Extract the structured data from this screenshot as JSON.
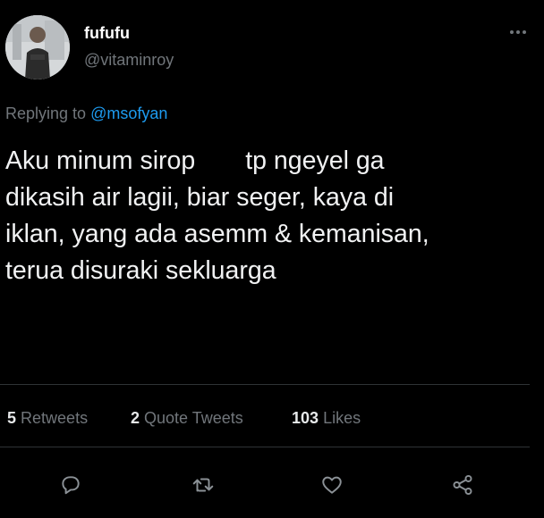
{
  "tweet": {
    "display_name": "fufufu",
    "handle": "@vitaminroy",
    "replying_prefix": "Replying to",
    "replying_to": "@msofyan",
    "body_lines": {
      "line1_a": "Aku minum sirop",
      "line1_b": "tp ngeyel ga",
      "line2": "dikasih air lagii, biar seger, kaya di",
      "line3": "iklan, yang ada asemm & kemanisan,",
      "line4": "terua disuraki sekluarga"
    }
  },
  "stats": {
    "retweets_count": "5",
    "retweets_label": "Retweets",
    "quote_count": "2",
    "quote_label": "Quote Tweets",
    "likes_count": "103",
    "likes_label": "Likes"
  },
  "actions": {
    "reply_icon": "reply-icon",
    "retweet_icon": "retweet-icon",
    "like_icon": "heart-icon",
    "share_icon": "share-icon"
  },
  "colors": {
    "background": "#000000",
    "link": "#1d9bf0",
    "secondary_text": "#71767b",
    "primary_text": "#e7e9ea"
  }
}
